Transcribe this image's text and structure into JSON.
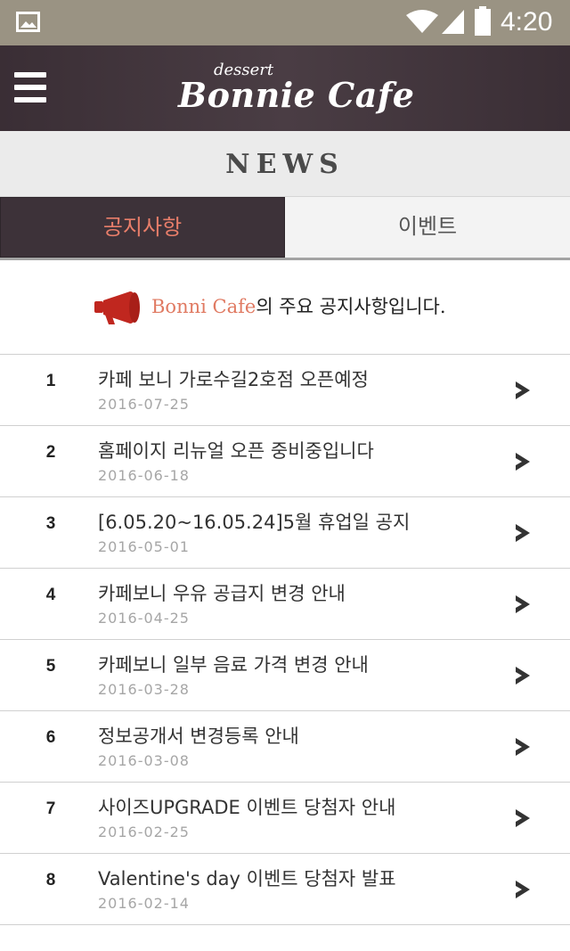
{
  "status_bar": {
    "time": "4:20",
    "icons": [
      "image-icon",
      "wifi-icon",
      "signal-icon",
      "battery-icon"
    ]
  },
  "header": {
    "tagline": "dessert",
    "brand": "Bonnie Cafe",
    "menu_icon": "hamburger-menu-icon"
  },
  "section": {
    "title": "NEWS"
  },
  "tabs": [
    {
      "label": "공지사항",
      "active": true
    },
    {
      "label": "이벤트",
      "active": false
    }
  ],
  "notice": {
    "brand": "Bonni Cafe",
    "text": "의 주요 공지사항입니다.",
    "icon": "megaphone-icon"
  },
  "news": [
    {
      "num": "1",
      "title": "카페 보니 가로수길2호점 오픈예정",
      "date": "2016-07-25"
    },
    {
      "num": "2",
      "title": "홈페이지 리뉴얼 오픈 중비중입니다",
      "date": "2016-06-18"
    },
    {
      "num": "3",
      "title": "[6.05.20~16.05.24]5월 휴업일 공지",
      "date": "2016-05-01"
    },
    {
      "num": "4",
      "title": "카페보니 우유 공급지 변경 안내",
      "date": "2016-04-25"
    },
    {
      "num": "5",
      "title": "카페보니 일부 음료 가격 변경 안내",
      "date": "2016-03-28"
    },
    {
      "num": "6",
      "title": "정보공개서 변경등록 안내",
      "date": "2016-03-08"
    },
    {
      "num": "7",
      "title": "사이즈UPGRADE 이벤트 당첨자 안내",
      "date": "2016-02-25"
    },
    {
      "num": "8",
      "title": "Valentine's day  이벤트 당첨자 발표",
      "date": "2016-02-14"
    }
  ],
  "colors": {
    "status_bar": "#9a9383",
    "header": "#3d3239",
    "accent": "#e87e6a",
    "megaphone": "#c0271f"
  }
}
